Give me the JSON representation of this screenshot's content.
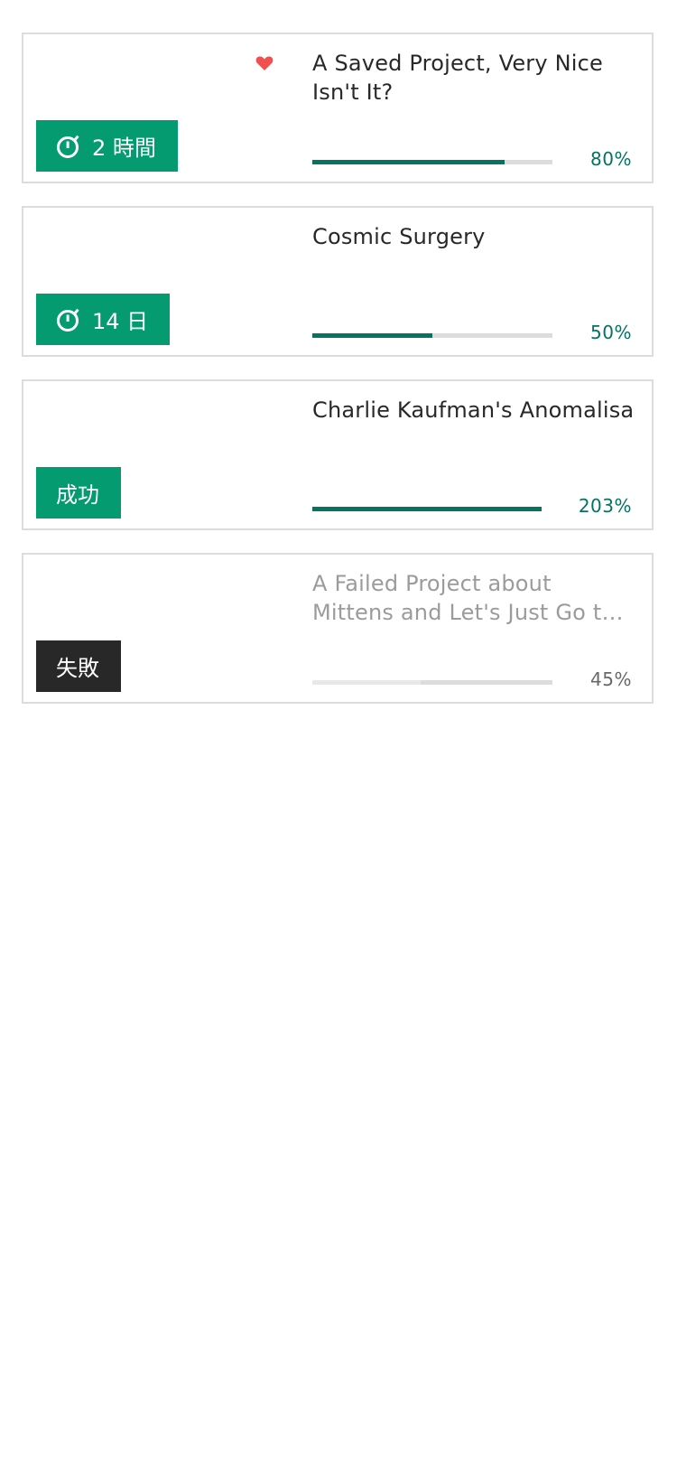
{
  "colors": {
    "accent_green": "#039b6f",
    "progress_green": "#037362",
    "failed_dark": "#282828",
    "heart_red": "#f05050",
    "track_gray": "#dcdcdc"
  },
  "projects": [
    {
      "title": "A Saved Project, Very Nice Isn't It?",
      "saved": true,
      "badge_icon": "stopwatch-icon",
      "badge_label": "2 時間",
      "percent_label": "80%",
      "progress_fraction": 0.8,
      "state": "live"
    },
    {
      "title": "Cosmic Surgery",
      "saved": false,
      "badge_icon": "stopwatch-icon",
      "badge_label": "14 日",
      "percent_label": "50%",
      "progress_fraction": 0.5,
      "state": "live"
    },
    {
      "title": "Charlie Kaufman's Anomalisa",
      "saved": false,
      "badge_icon": "",
      "badge_label": "成功",
      "percent_label": "203%",
      "progress_fraction": 1.0,
      "state": "successful"
    },
    {
      "title": "A Failed Project about Mittens and Let's Just Go to the Next Line",
      "saved": false,
      "badge_icon": "",
      "badge_label": "失敗",
      "percent_label": "45%",
      "progress_fraction": 0.45,
      "state": "failed"
    }
  ]
}
